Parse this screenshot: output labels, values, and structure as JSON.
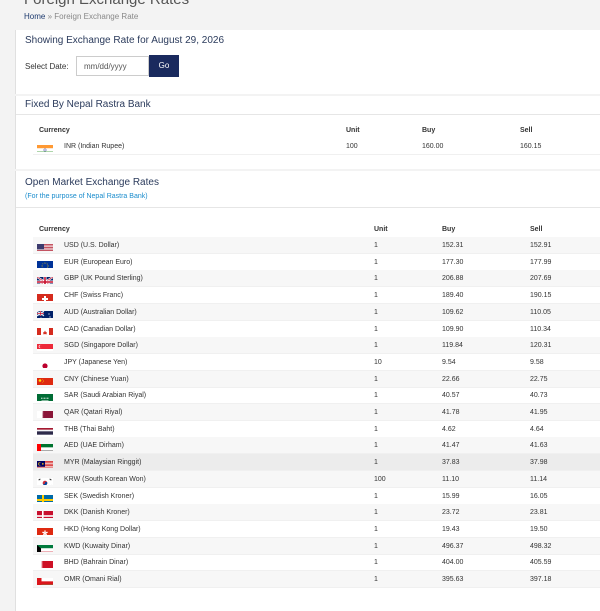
{
  "header": {
    "title": "Foreign Exchange Rates",
    "breadcrumb_home": "Home",
    "breadcrumb_sep": "»",
    "breadcrumb_current": "Foreign Exchange Rate"
  },
  "date_panel": {
    "heading": "Showing Exchange Rate for August 29, 2026",
    "select_label": "Select Date:",
    "date_placeholder": "mm/dd/yyyy",
    "go_label": "Go"
  },
  "fixed": {
    "heading": "Fixed By Nepal Rastra Bank",
    "columns": [
      "Currency",
      "Unit",
      "Buy",
      "Sell"
    ],
    "row": {
      "currency": "INR (Indian Rupee)",
      "unit": "100",
      "buy": "160.00",
      "sell": "160.15",
      "flag": "india-flag-icon"
    }
  },
  "open_market": {
    "heading": "Open Market Exchange Rates",
    "subheading": "(For the purpose of Nepal Rastra Bank)",
    "columns": [
      "Currency",
      "Unit",
      "Buy",
      "Sell"
    ],
    "rows": [
      {
        "currency": "USD (U.S. Dollar)",
        "unit": "1",
        "buy": "152.31",
        "sell": "152.91",
        "flag": "us"
      },
      {
        "currency": "EUR (European Euro)",
        "unit": "1",
        "buy": "177.30",
        "sell": "177.99",
        "flag": "eu"
      },
      {
        "currency": "GBP (UK Pound Sterling)",
        "unit": "1",
        "buy": "206.88",
        "sell": "207.69",
        "flag": "gb"
      },
      {
        "currency": "CHF (Swiss Franc)",
        "unit": "1",
        "buy": "189.40",
        "sell": "190.15",
        "flag": "ch"
      },
      {
        "currency": "AUD (Australian Dollar)",
        "unit": "1",
        "buy": "109.62",
        "sell": "110.05",
        "flag": "au"
      },
      {
        "currency": "CAD (Canadian Dollar)",
        "unit": "1",
        "buy": "109.90",
        "sell": "110.34",
        "flag": "ca"
      },
      {
        "currency": "SGD (Singapore Dollar)",
        "unit": "1",
        "buy": "119.84",
        "sell": "120.31",
        "flag": "sg"
      },
      {
        "currency": "JPY (Japanese Yen)",
        "unit": "10",
        "buy": "9.54",
        "sell": "9.58",
        "flag": "jp"
      },
      {
        "currency": "CNY (Chinese Yuan)",
        "unit": "1",
        "buy": "22.66",
        "sell": "22.75",
        "flag": "cn"
      },
      {
        "currency": "SAR (Saudi Arabian Riyal)",
        "unit": "1",
        "buy": "40.57",
        "sell": "40.73",
        "flag": "sa"
      },
      {
        "currency": "QAR (Qatari Riyal)",
        "unit": "1",
        "buy": "41.78",
        "sell": "41.95",
        "flag": "qa"
      },
      {
        "currency": "THB (Thai Baht)",
        "unit": "1",
        "buy": "4.62",
        "sell": "4.64",
        "flag": "th"
      },
      {
        "currency": "AED (UAE Dirham)",
        "unit": "1",
        "buy": "41.47",
        "sell": "41.63",
        "flag": "ae"
      },
      {
        "currency": "MYR (Malaysian Ringgit)",
        "unit": "1",
        "buy": "37.83",
        "sell": "37.98",
        "flag": "my"
      },
      {
        "currency": "KRW (South Korean Won)",
        "unit": "100",
        "buy": "11.10",
        "sell": "11.14",
        "flag": "kr"
      },
      {
        "currency": "SEK (Swedish Kroner)",
        "unit": "1",
        "buy": "15.99",
        "sell": "16.05",
        "flag": "se"
      },
      {
        "currency": "DKK (Danish Kroner)",
        "unit": "1",
        "buy": "23.72",
        "sell": "23.81",
        "flag": "dk"
      },
      {
        "currency": "HKD (Hong Kong Dollar)",
        "unit": "1",
        "buy": "19.43",
        "sell": "19.50",
        "flag": "hk"
      },
      {
        "currency": "KWD (Kuwaity Dinar)",
        "unit": "1",
        "buy": "496.37",
        "sell": "498.32",
        "flag": "kw"
      },
      {
        "currency": "BHD (Bahrain Dinar)",
        "unit": "1",
        "buy": "404.00",
        "sell": "405.59",
        "flag": "bh"
      },
      {
        "currency": "OMR (Omani Rial)",
        "unit": "1",
        "buy": "395.63",
        "sell": "397.18",
        "flag": "om"
      }
    ]
  },
  "colors": {
    "accent": "#1a2a5e",
    "link": "#1a8ccd",
    "heading": "#2b3b5c"
  }
}
